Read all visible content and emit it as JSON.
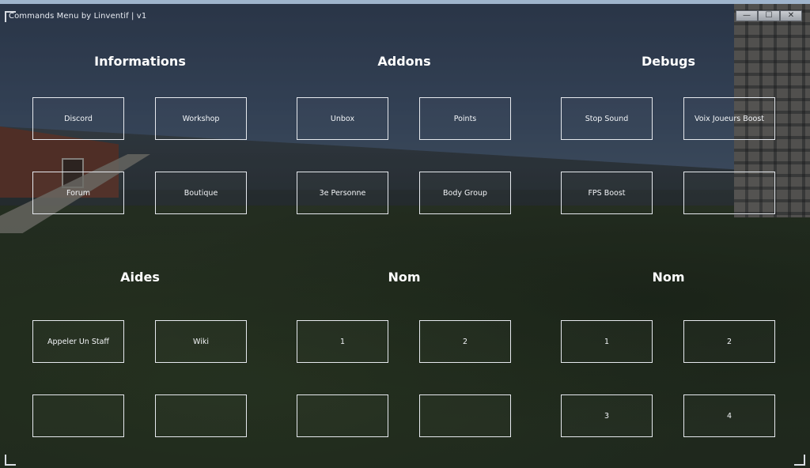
{
  "window": {
    "title": "Commands Menu by Linventif | v1",
    "minimize_glyph": "—",
    "maximize_glyph": "☐",
    "close_glyph": "✕"
  },
  "sections": {
    "informations": {
      "title": "Informations",
      "buttons": [
        "Discord",
        "Workshop",
        "Forum",
        "Boutique"
      ]
    },
    "addons": {
      "title": "Addons",
      "buttons": [
        "Unbox",
        "Points",
        "3e Personne",
        "Body Group"
      ]
    },
    "debugs": {
      "title": "Debugs",
      "buttons": [
        "Stop Sound",
        "Voix Joueurs Boost",
        "FPS  Boost",
        ""
      ]
    },
    "aides": {
      "title": "Aides",
      "buttons": [
        "Appeler Un Staff",
        "Wiki",
        "",
        ""
      ]
    },
    "nom1": {
      "title": "Nom",
      "buttons": [
        "1",
        "2",
        "",
        ""
      ]
    },
    "nom2": {
      "title": "Nom",
      "buttons": [
        "1",
        "2",
        "3",
        "4"
      ]
    }
  },
  "colors": {
    "window_border": "#9fb4cc",
    "button_border": "#e6e9ee",
    "text": "#ffffff"
  }
}
